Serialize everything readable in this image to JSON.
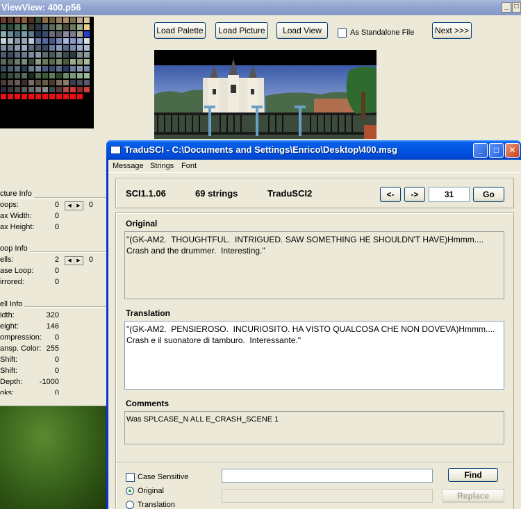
{
  "viewview": {
    "title": "ViewView: 400.p56",
    "buttons": {
      "load_palette": "Load Palette",
      "load_picture": "Load Picture",
      "load_view": "Load View",
      "next": "Next >>>"
    },
    "standalone_label": "As Standalone File",
    "palette_colors": [
      "#6b3b2b",
      "#5a3a2a",
      "#7a4b3b",
      "#8b5b3b",
      "#4a3020",
      "#3a4a30",
      "#8b6b4b",
      "#6b5b3b",
      "#9b7b5b",
      "#ab8b6b",
      "#7b6b4b",
      "#bba58a",
      "#d9c99a",
      "#3b5b4b",
      "#2b4b3b",
      "#4b6b5b",
      "#5b7b6b",
      "#3b3b2b",
      "#2b3b4b",
      "#4b5b6b",
      "#5b6b5b",
      "#7b8b6b",
      "#4b4b3b",
      "#6b7b5b",
      "#9bab8b",
      "#e8d08a",
      "#8babab",
      "#6b8b9b",
      "#4b6b7b",
      "#7b9bab",
      "#5b7b8b",
      "#2b3b5b",
      "#3b4b6b",
      "#6b6b7b",
      "#5b5b6b",
      "#8b8b9b",
      "#7b7b8b",
      "#abab9b",
      "#1f3fd0",
      "#c8d0d8",
      "#a8b8c8",
      "#8898a8",
      "#98a8b8",
      "#b8c8d8",
      "#6878a0",
      "#5868a0",
      "#485890",
      "#7888b0",
      "#a8b8d8",
      "#8898c8",
      "#98a8d8",
      "#d8e0e8",
      "#7b8b9b",
      "#6b7b8b",
      "#8b9bab",
      "#9babbb",
      "#5b6b7b",
      "#4b5b6b",
      "#3b4b5b",
      "#6b7b9b",
      "#8b9bbb",
      "#5b6b8b",
      "#7b8bab",
      "#9babcb",
      "#abbbcb",
      "#4b5b6b",
      "#3b4b5b",
      "#5b6b7b",
      "#6b7b8b",
      "#7b8b9b",
      "#8b9bab",
      "#5b6b6b",
      "#4b5b5b",
      "#6b7b7b",
      "#3b4b4b",
      "#2b3b3b",
      "#7b8b8b",
      "#8b9b9b",
      "#5b6b5b",
      "#4b5b4b",
      "#6b7b6b",
      "#7b8b7b",
      "#3b4b3b",
      "#8b9b8b",
      "#6b7b5b",
      "#5b6b4b",
      "#7b8b6b",
      "#4b5b3b",
      "#9bab8b",
      "#8b9b7b",
      "#abbb9b",
      "#3b4b5b",
      "#4b5b6b",
      "#5b6b7b",
      "#2b3b4b",
      "#6b7b8b",
      "#7b8b9b",
      "#4b5b7b",
      "#3b4b6b",
      "#5b6b8b",
      "#2b3b5b",
      "#6b7b9b",
      "#8b9bab",
      "#7b8bab",
      "#2b3b2b",
      "#3b4b3b",
      "#4b5b4b",
      "#5b6b5b",
      "#1b2b1b",
      "#4b6b4b",
      "#3b5b3b",
      "#5b7b5b",
      "#2b4b2b",
      "#6b8b6b",
      "#7b9b7b",
      "#8bab8b",
      "#9bbb9b",
      "#4b3b3b",
      "#5b4b4b",
      "#6b5b5b",
      "#3b2b2b",
      "#7b6b6b",
      "#5b4b3b",
      "#6b5b4b",
      "#4b3b2b",
      "#7b6b5b",
      "#8b7b6b",
      "#3b3b4b",
      "#4b4b5b",
      "#5b5b6b",
      "#2b2b3b",
      "#3b3b3b",
      "#4b4b4b",
      "#5b5b5b",
      "#6b6b6b",
      "#7b7b7b",
      "#8b8b8b",
      "#3b4b4b",
      "#5b3b3b",
      "#ab4b4b",
      "#cb3b3b",
      "#8b2b2b",
      "#d33a3a",
      "#e81010",
      "#e81010",
      "#e81010",
      "#e81010",
      "#e81010",
      "#e81010",
      "#e81010",
      "#e81010",
      "#e81010",
      "#e81010",
      "#e81010",
      "#e81010",
      "#000000"
    ],
    "picture_info": {
      "title": "cture Info",
      "rows": [
        {
          "label": "oops:",
          "value": "0",
          "extra": "0",
          "spin": true
        },
        {
          "label": "ax Width:",
          "value": "0"
        },
        {
          "label": "ax Height:",
          "value": "0"
        }
      ]
    },
    "loop_info": {
      "title": "oop Info",
      "rows": [
        {
          "label": "ells:",
          "value": "2",
          "extra": "0",
          "spin": true
        },
        {
          "label": "ase Loop:",
          "value": "0"
        },
        {
          "label": "irrored:",
          "value": "0"
        }
      ]
    },
    "cell_info": {
      "title": "ell Info",
      "rows": [
        {
          "label": "idth:",
          "value": "320"
        },
        {
          "label": "eight:",
          "value": "146"
        },
        {
          "label": "ompression:",
          "value": "0"
        },
        {
          "label": "ansp. Color:",
          "value": "255"
        },
        {
          "label": "Shift:",
          "value": "0"
        },
        {
          "label": "Shift:",
          "value": "0"
        },
        {
          "label": "Depth:",
          "value": "-1000"
        },
        {
          "label": "oks:",
          "value": "0"
        }
      ]
    }
  },
  "traduSCI": {
    "title": "TraduSCI - C:\\Documents and Settings\\Enrico\\Desktop\\400.msg",
    "menu": [
      "Message",
      "Strings",
      "Font"
    ],
    "header": {
      "version": "SCI1.1.06",
      "count": "69 strings",
      "app": "TraduSCI2",
      "prev": "<-",
      "next": "->",
      "index": "31",
      "go": "Go"
    },
    "original": {
      "label": "Original",
      "text": "\"(GK-AM2.  THOUGHTFUL.  INTRIGUED. SAW SOMETHING HE SHOULDN'T HAVE)Hmmm....  Crash and the drummer.  Interesting.\""
    },
    "translation": {
      "label": "Translation",
      "text": "\"(GK-AM2.  PENSIEROSO.  INCURIOSITO. HA VISTO QUALCOSA CHE NON DOVEVA)Hmmm....  Crash e il suonatore di tamburo.  Interessante.\""
    },
    "comments": {
      "label": "Comments",
      "text": "Was SPLCASE_N ALL E_CRASH_SCENE 1"
    },
    "search": {
      "case_sensitive": "Case Sensitive",
      "original": "Original",
      "translation": "Translation",
      "find": "Find",
      "replace": "Replace",
      "find_value": "",
      "replace_value": ""
    }
  }
}
